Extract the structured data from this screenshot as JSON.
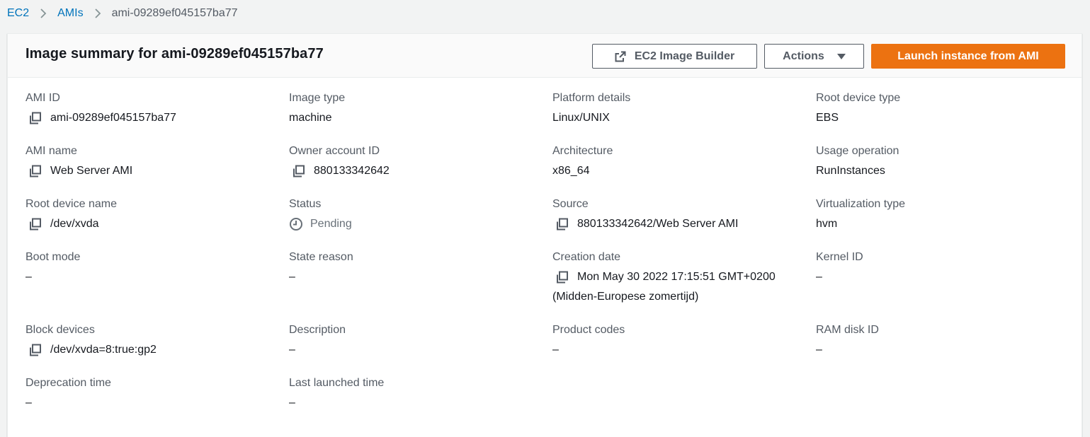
{
  "breadcrumb": {
    "items": [
      "EC2",
      "AMIs"
    ],
    "current": "ami-09289ef045157ba77"
  },
  "panel": {
    "title": "Image summary for ami-09289ef045157ba77",
    "buttons": {
      "image_builder": "EC2 Image Builder",
      "actions": "Actions",
      "launch": "Launch instance from AMI"
    }
  },
  "colors": {
    "link": "#0073bb",
    "primary": "#ec7211",
    "label": "#545b64"
  },
  "icons": {
    "breadcrumb_separator": "chevron-right-icon",
    "image_builder": "external-link-icon",
    "actions": "caret-down-icon",
    "copy": "copy-icon",
    "status": "clock-icon"
  },
  "fields": {
    "ami_id": {
      "label": "AMI ID",
      "value": "ami-09289ef045157ba77"
    },
    "image_type": {
      "label": "Image type",
      "value": "machine"
    },
    "platform_details": {
      "label": "Platform details",
      "value": "Linux/UNIX"
    },
    "root_device_type": {
      "label": "Root device type",
      "value": "EBS"
    },
    "ami_name": {
      "label": "AMI name",
      "value": "Web Server AMI"
    },
    "owner_account_id": {
      "label": "Owner account ID",
      "value": "880133342642"
    },
    "architecture": {
      "label": "Architecture",
      "value": "x86_64"
    },
    "usage_operation": {
      "label": "Usage operation",
      "value": "RunInstances"
    },
    "root_device_name": {
      "label": "Root device name",
      "value": "/dev/xvda"
    },
    "status": {
      "label": "Status",
      "value": "Pending"
    },
    "source": {
      "label": "Source",
      "value": "880133342642/Web Server AMI"
    },
    "virtualization_type": {
      "label": "Virtualization type",
      "value": "hvm"
    },
    "boot_mode": {
      "label": "Boot mode",
      "value": "–"
    },
    "state_reason": {
      "label": "State reason",
      "value": "–"
    },
    "creation_date": {
      "label": "Creation date",
      "value_line1": "Mon May 30 2022 17:15:51 GMT+0200",
      "value_line2": "(Midden-Europese zomertijd)"
    },
    "kernel_id": {
      "label": "Kernel ID",
      "value": "–"
    },
    "block_devices": {
      "label": "Block devices",
      "value": "/dev/xvda=8:true:gp2"
    },
    "description": {
      "label": "Description",
      "value": "–"
    },
    "product_codes": {
      "label": "Product codes",
      "value": "–"
    },
    "ram_disk_id": {
      "label": "RAM disk ID",
      "value": "–"
    },
    "deprecation_time": {
      "label": "Deprecation time",
      "value": "–"
    },
    "last_launched_time": {
      "label": "Last launched time",
      "value": "–"
    }
  }
}
